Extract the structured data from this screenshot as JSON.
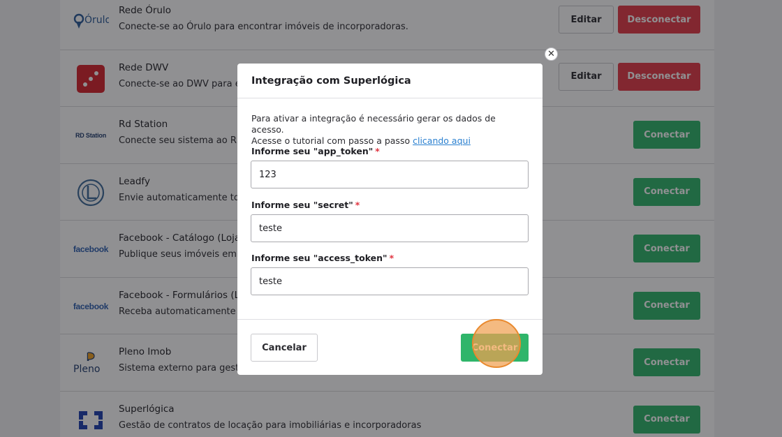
{
  "integrations": [
    {
      "title": "Rede Órulo",
      "description": "Conecte-se ao Órulo para encontrar imóveis de incorporadoras.",
      "logo_icon": "orulo-logo-icon",
      "logo_text": "Órulo",
      "actions": [
        "Editar",
        "Desconectar"
      ]
    },
    {
      "title": "Rede DWV",
      "description": "Conecte-se ao DWV para encontrar imóveis de incorporadoras.",
      "logo_icon": "dwv-logo-icon",
      "logo_text": "",
      "actions": [
        "Editar",
        "Desconectar"
      ]
    },
    {
      "title": "Rd Station",
      "description": "Conecte seu sistema ao RD Station.",
      "logo_icon": "rdstation-logo-icon",
      "logo_text": "RD Station",
      "actions": [
        "Conectar"
      ]
    },
    {
      "title": "Leadfy",
      "description": "Envie automaticamente todos os seus leads.",
      "logo_icon": "leadfy-logo-icon",
      "logo_text": "",
      "actions": [
        "Conectar"
      ]
    },
    {
      "title": "Facebook - Catálogo (Loja)",
      "description": "Publique seus imóveis em sua loja do Facebook.",
      "logo_icon": "facebook-logo-icon",
      "logo_text": "facebook",
      "actions": [
        "Conectar"
      ]
    },
    {
      "title": "Facebook - Formulários (Leads)",
      "description": "Receba automaticamente leads do Facebook.",
      "logo_icon": "facebook-logo-icon",
      "logo_text": "facebook",
      "actions": [
        "Conectar"
      ]
    },
    {
      "title": "Pleno Imob",
      "description": "Sistema externo para gestão de imóveis.",
      "logo_icon": "pleno-logo-icon",
      "logo_text": "Pleno",
      "actions": [
        "Conectar"
      ]
    },
    {
      "title": "Superlógica",
      "description": "Gestão de contratos de locação para imobiliárias e incorporadoras",
      "logo_icon": "superlogica-logo-icon",
      "logo_text": "",
      "actions": [
        "Conectar"
      ]
    }
  ],
  "colors": {
    "connect": "#2fb56a",
    "disconnect": "#e53a46",
    "link": "#2a80d0",
    "required": "#e0333f",
    "click_highlight": "#e98a2f"
  },
  "modal": {
    "title": "Integração com Superlógica",
    "intro_line1": "Para ativar a integração é necessário gerar os dados de acesso.",
    "intro_line2": "Acesse o tutorial com passo a passo",
    "intro_link": "clicando aqui",
    "close_icon": "close-icon",
    "close_symbol": "✕",
    "required_mark": "*",
    "fields": [
      {
        "label": "Informe seu \"app_token\"",
        "value": "123"
      },
      {
        "label": "Informe seu \"secret\"",
        "value": "teste"
      },
      {
        "label": "Informe seu \"access_token\"",
        "value": "teste"
      }
    ],
    "cancel_label": "Cancelar",
    "connect_label": "Conectar"
  }
}
